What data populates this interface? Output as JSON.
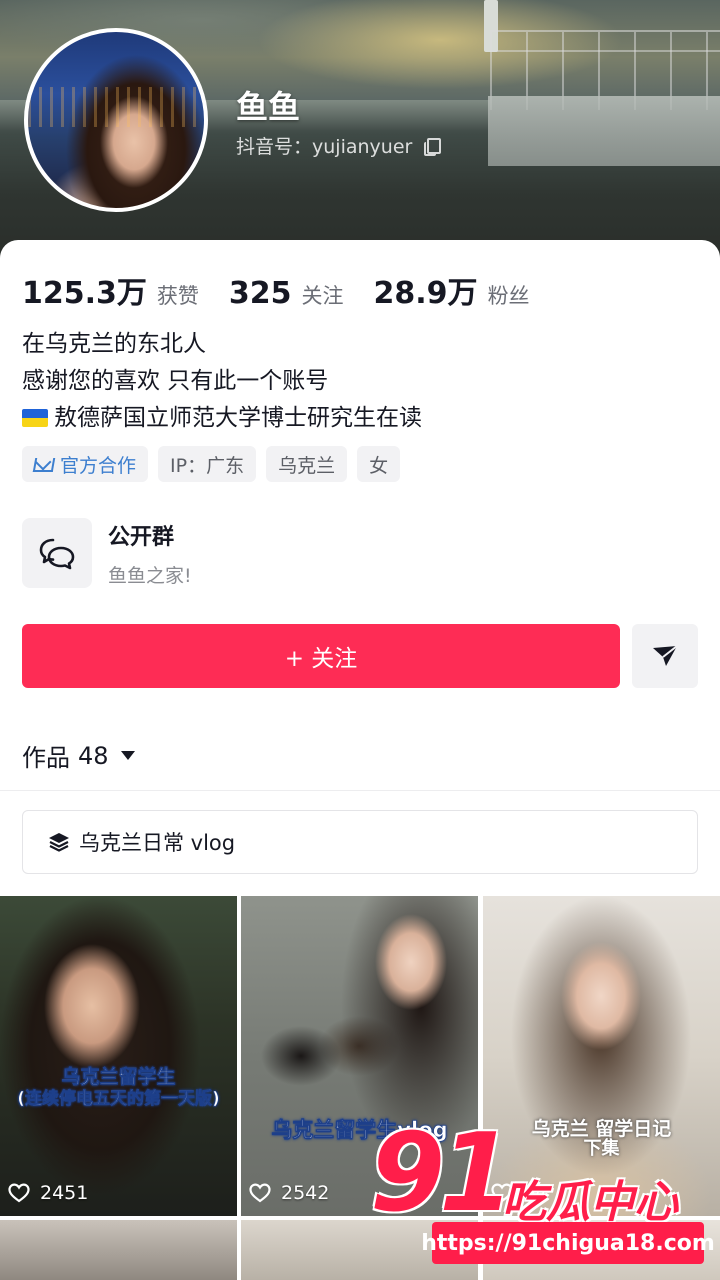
{
  "profile": {
    "name": "鱼鱼",
    "douyin_id": "抖音号：yujianyuer"
  },
  "stats": [
    {
      "value": "125.3万",
      "label": "获赞"
    },
    {
      "value": "325",
      "label": "关注"
    },
    {
      "value": "28.9万",
      "label": "粉丝"
    }
  ],
  "bio": {
    "line1": "在乌克兰的东北人",
    "line2": "感谢您的喜欢 只有此一个账号",
    "line3": "敖德萨国立师范大学博士研究生在读"
  },
  "tags": {
    "official": "官方合作",
    "ip": "IP：广东",
    "location": "乌克兰",
    "gender": "女"
  },
  "group": {
    "title": "公开群",
    "subtitle": "鱼鱼之家!"
  },
  "actions": {
    "follow": "+ 关注"
  },
  "works": {
    "label": "作品",
    "count": "48"
  },
  "collection": {
    "label": "乌克兰日常 vlog"
  },
  "videos": [
    {
      "caption_line1": "乌克兰留学生",
      "caption_line2": "(连续停电五天的第一天版)",
      "likes": "2451"
    },
    {
      "caption_line1": "乌克兰留学生vlog",
      "caption_line2": "",
      "likes": "2542"
    },
    {
      "caption_line1": "乌克兰 留学日记",
      "caption_line2": "下集",
      "likes": "14"
    }
  ],
  "watermark": {
    "number": "91",
    "text": "吃瓜中心",
    "url": "https://91chigua18.com"
  },
  "colors": {
    "accent": "#fe2c55",
    "official_tag": "#3d7fcf",
    "watermark": "#ff1e4a"
  },
  "icons": [
    "copy-icon",
    "official-icon",
    "group-chat-icon",
    "share-icon",
    "caret-down-icon",
    "stack-icon",
    "heart-icon"
  ]
}
